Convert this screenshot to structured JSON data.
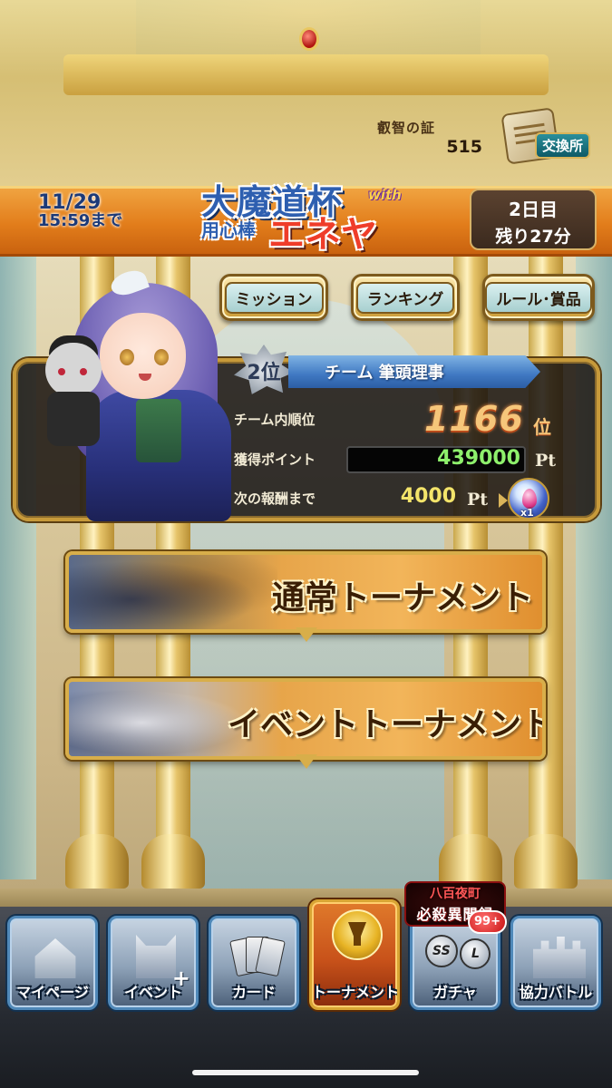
{
  "currency": {
    "label": "叡智の証",
    "value": "515",
    "exchange_label": "交換所"
  },
  "event": {
    "deadline_date": "11/29",
    "deadline_time": "15:59まで",
    "logo_line1": "大魔道杯",
    "logo_with": "with",
    "logo_line2a": "用心棒",
    "logo_line2b": "エネヤ",
    "day": "2日目",
    "remaining": "残り27分"
  },
  "menu": {
    "mission": "ミッション",
    "ranking": "ランキング",
    "rules": "ルール･賞品"
  },
  "ranking": {
    "team_rank": "2位",
    "team_name": "チーム 筆頭理事",
    "in_team_rank_label": "チーム内順位",
    "in_team_rank_value": "1166",
    "in_team_rank_unit": "位",
    "points_label": "獲得ポイント",
    "points_value": "439000",
    "points_unit": "Pt",
    "next_reward_label": "次の報酬まで",
    "next_reward_value": "4000",
    "next_reward_unit": "Pt",
    "reward_count": "x1"
  },
  "tournaments": {
    "normal": "通常トーナメント",
    "event": "イベントトーナメント"
  },
  "nav": {
    "mypage": "マイページ",
    "event": "イベント",
    "event_plus": "+",
    "card": "カード",
    "tournament": "トーナメント",
    "gacha": "ガチャ",
    "gacha_badge": "99+",
    "gacha_ball1": "SS",
    "gacha_ball2": "L",
    "gacha_event_line1": "八百夜町",
    "gacha_event_line2": "必殺異聞録",
    "coop": "協力バトル"
  },
  "colors": {
    "accent_orange": "#e27d1b",
    "points_green": "#8ef06c",
    "rank_gold": "#f6c67a",
    "team_blue": "#3f78c2"
  }
}
